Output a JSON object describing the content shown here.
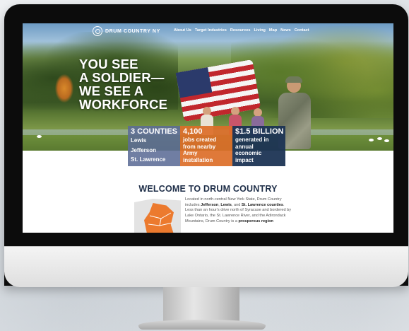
{
  "nav": {
    "logo_text": "DRUM COUNTRY NY",
    "links": [
      "About Us",
      "Target Industries",
      "Resources",
      "Living",
      "Map",
      "News",
      "Contact"
    ]
  },
  "hero": {
    "headline": [
      "YOU SEE",
      "A SOLDIER—",
      "WE SEE A",
      "WORKFORCE"
    ],
    "stats": [
      {
        "big": "3 COUNTIES",
        "lines": [
          "Lewis",
          "Jefferson",
          "St. Lawrence"
        ]
      },
      {
        "big": "4,100",
        "lines": [
          "jobs created",
          "from nearby",
          "Army",
          "installation"
        ]
      },
      {
        "big": "$1.5 BILLION",
        "lines": [
          "generated in",
          "annual",
          "economic",
          "impact"
        ]
      }
    ]
  },
  "welcome": {
    "title": "WELCOME TO DRUM COUNTRY",
    "text_parts": [
      {
        "t": "Located in north-central New York State, Drum Country includes ",
        "b": false
      },
      {
        "t": "Jefferson",
        "b": true
      },
      {
        "t": ", ",
        "b": false
      },
      {
        "t": "Lewis",
        "b": true
      },
      {
        "t": ", and ",
        "b": false
      },
      {
        "t": "St. Lawrence counties",
        "b": true
      },
      {
        "t": ". Less than an hour's drive north of Syracuse and bordered by Lake Ontario, the St. Lawrence River, and the Adirondack Mountains, Drum Country is a ",
        "b": false
      },
      {
        "t": "prosperous region",
        "b": true
      }
    ]
  },
  "colors": {
    "stat_1": "#5c6c96",
    "stat_2": "#dc6e28",
    "stat_3": "#1c3454",
    "title": "#1e2e48",
    "map_accent": "#ec7a2e"
  }
}
